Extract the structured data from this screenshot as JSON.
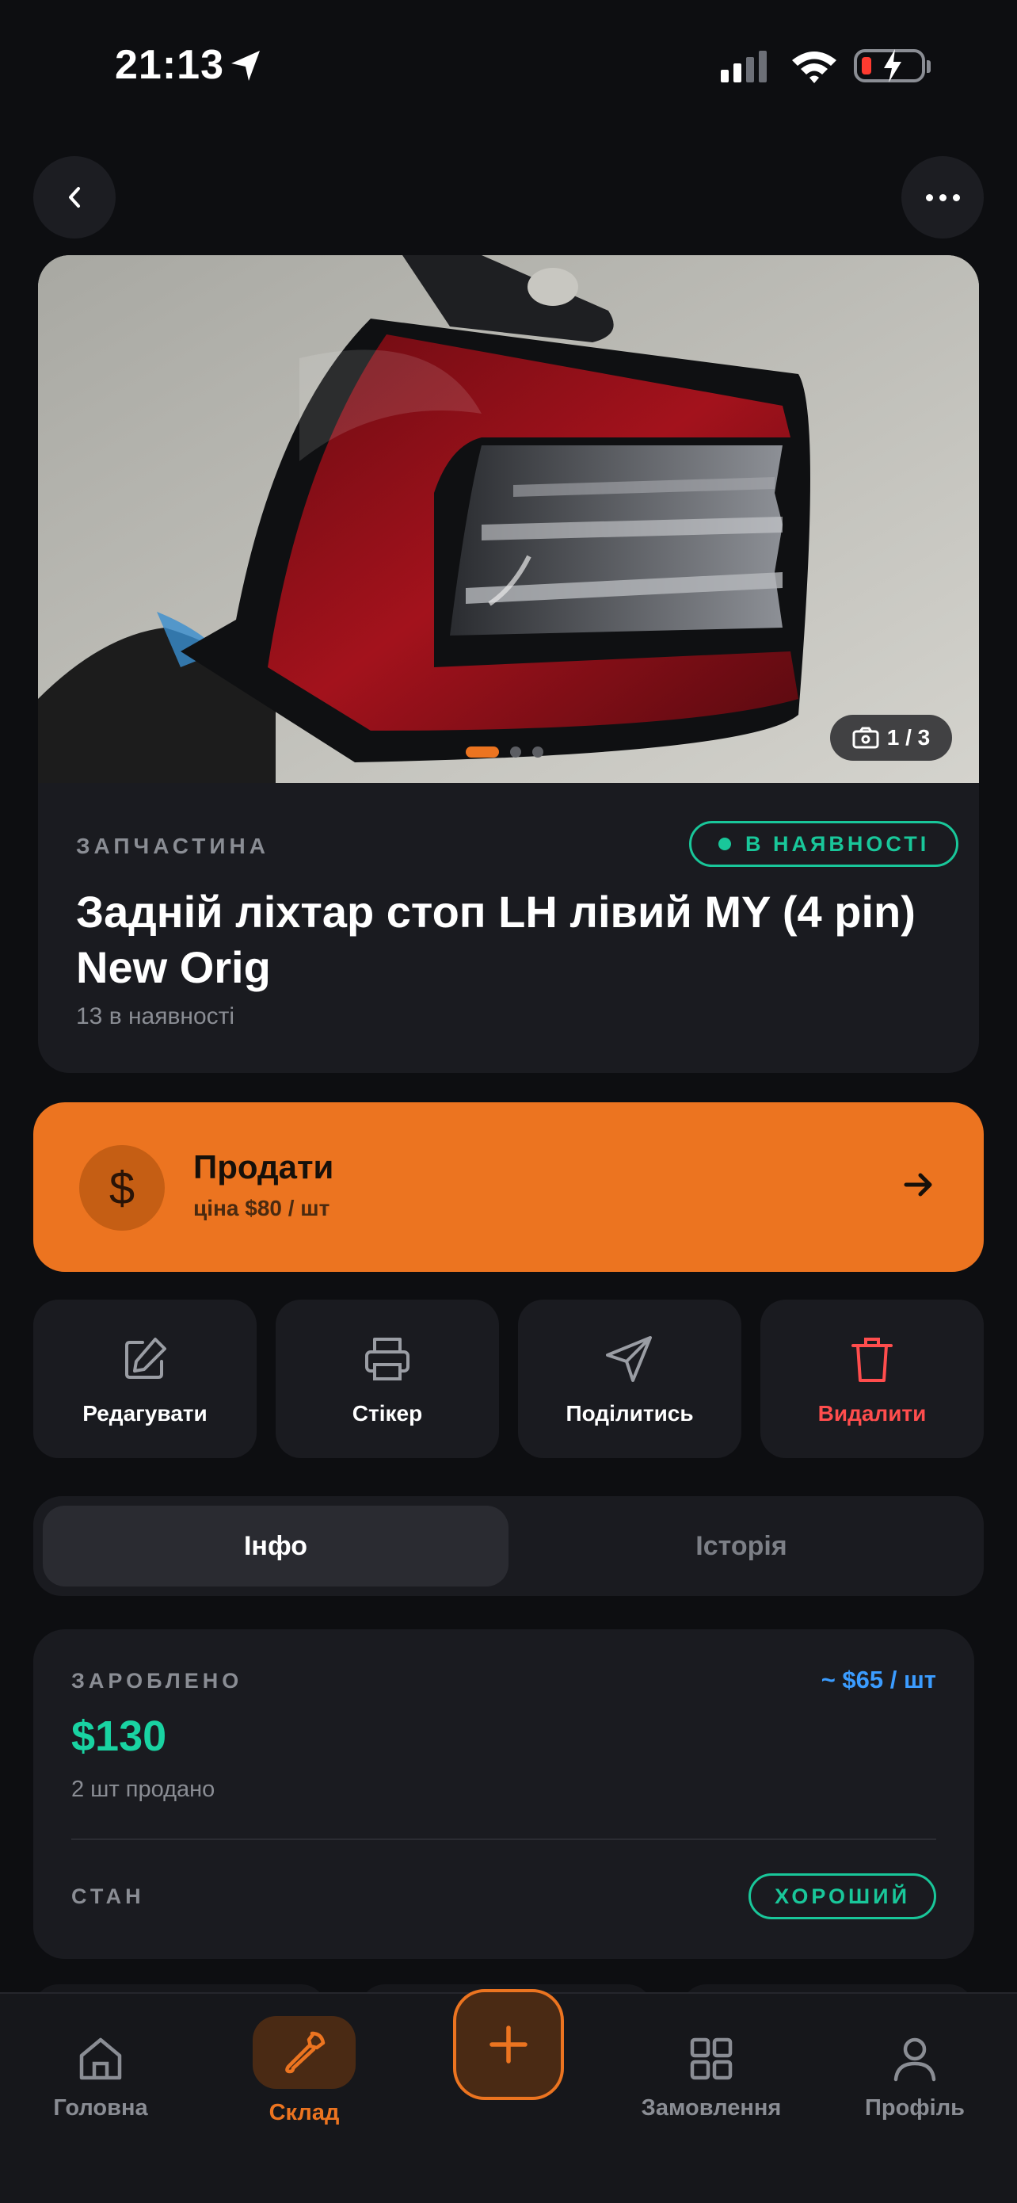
{
  "status_bar": {
    "time": "21:13"
  },
  "header": {
    "back_icon": "chevron-left-icon",
    "more_icon": "ellipsis-icon"
  },
  "product": {
    "photo_counter": "1 / 3",
    "category": "ЗАПЧАСТИНА",
    "stock_status": "В НАЯВНОСТІ",
    "title": "Задній ліхтар стоп LH лівий MY (4 pin) New Orig",
    "quantity": "13 в наявності"
  },
  "sell": {
    "label": "Продати",
    "price": "ціна $80 / шт"
  },
  "actions": [
    {
      "label": "Редагувати",
      "icon": "edit-icon"
    },
    {
      "label": "Стікер",
      "icon": "printer-icon"
    },
    {
      "label": "Поділитись",
      "icon": "send-icon"
    },
    {
      "label": "Видалити",
      "icon": "trash-icon"
    }
  ],
  "tabs": {
    "active": "Інфо",
    "other": "Історія"
  },
  "info": {
    "earned_label": "ЗАРОБЛЕНО",
    "per_unit": "~ $65 / шт",
    "earned": "$130",
    "sold": "2 шт продано",
    "condition_label": "СТАН",
    "condition": "ХОРОШИЙ"
  },
  "nav": {
    "home": "Головна",
    "warehouse": "Склад",
    "orders": "Замовлення",
    "profile": "Профіль"
  },
  "colors": {
    "accent": "#ec7420",
    "success": "#19c79a",
    "info": "#3b9cff",
    "danger": "#ff4d4d",
    "background": "#0d0e11"
  }
}
